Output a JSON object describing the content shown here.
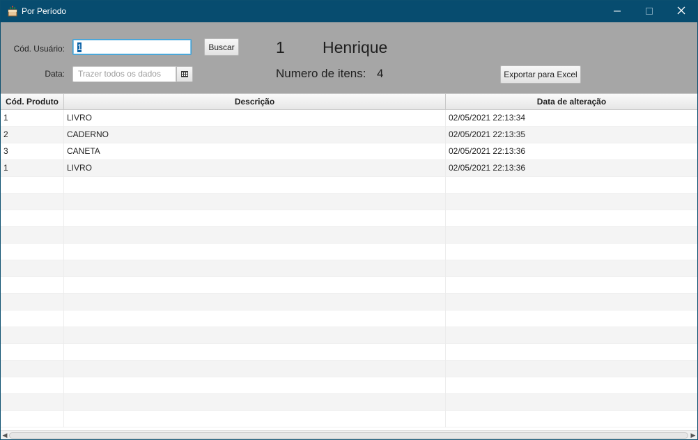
{
  "window": {
    "title": "Por Período",
    "icons": {
      "app": "cake-box-icon",
      "minimize": "minimize-icon",
      "maximize": "maximize-icon",
      "close": "close-icon"
    }
  },
  "toolbar": {
    "user_code_label": "Cód. Usuário:",
    "user_code_value": "1",
    "search_button": "Buscar",
    "date_label": "Data:",
    "date_placeholder": "Trazer todos os dados",
    "calendar_icon": "calendar-icon",
    "user_id": "1",
    "user_name": "Henrique",
    "items_label": "Numero de itens:",
    "items_count": "4",
    "export_button": "Exportar para Excel"
  },
  "table": {
    "columns": [
      "Cód. Produto",
      "Descrição",
      "Data de alteração"
    ],
    "rows": [
      [
        "1",
        "LIVRO",
        "02/05/2021 22:13:34"
      ],
      [
        "2",
        "CADERNO",
        "02/05/2021 22:13:35"
      ],
      [
        "3",
        "CANETA",
        "02/05/2021 22:13:36"
      ],
      [
        "1",
        "LIVRO",
        "02/05/2021 22:13:36"
      ]
    ]
  },
  "colors": {
    "titlebar": "#074c6f",
    "toolbar": "#a6a6a6",
    "focus": "#3c9fd4"
  }
}
